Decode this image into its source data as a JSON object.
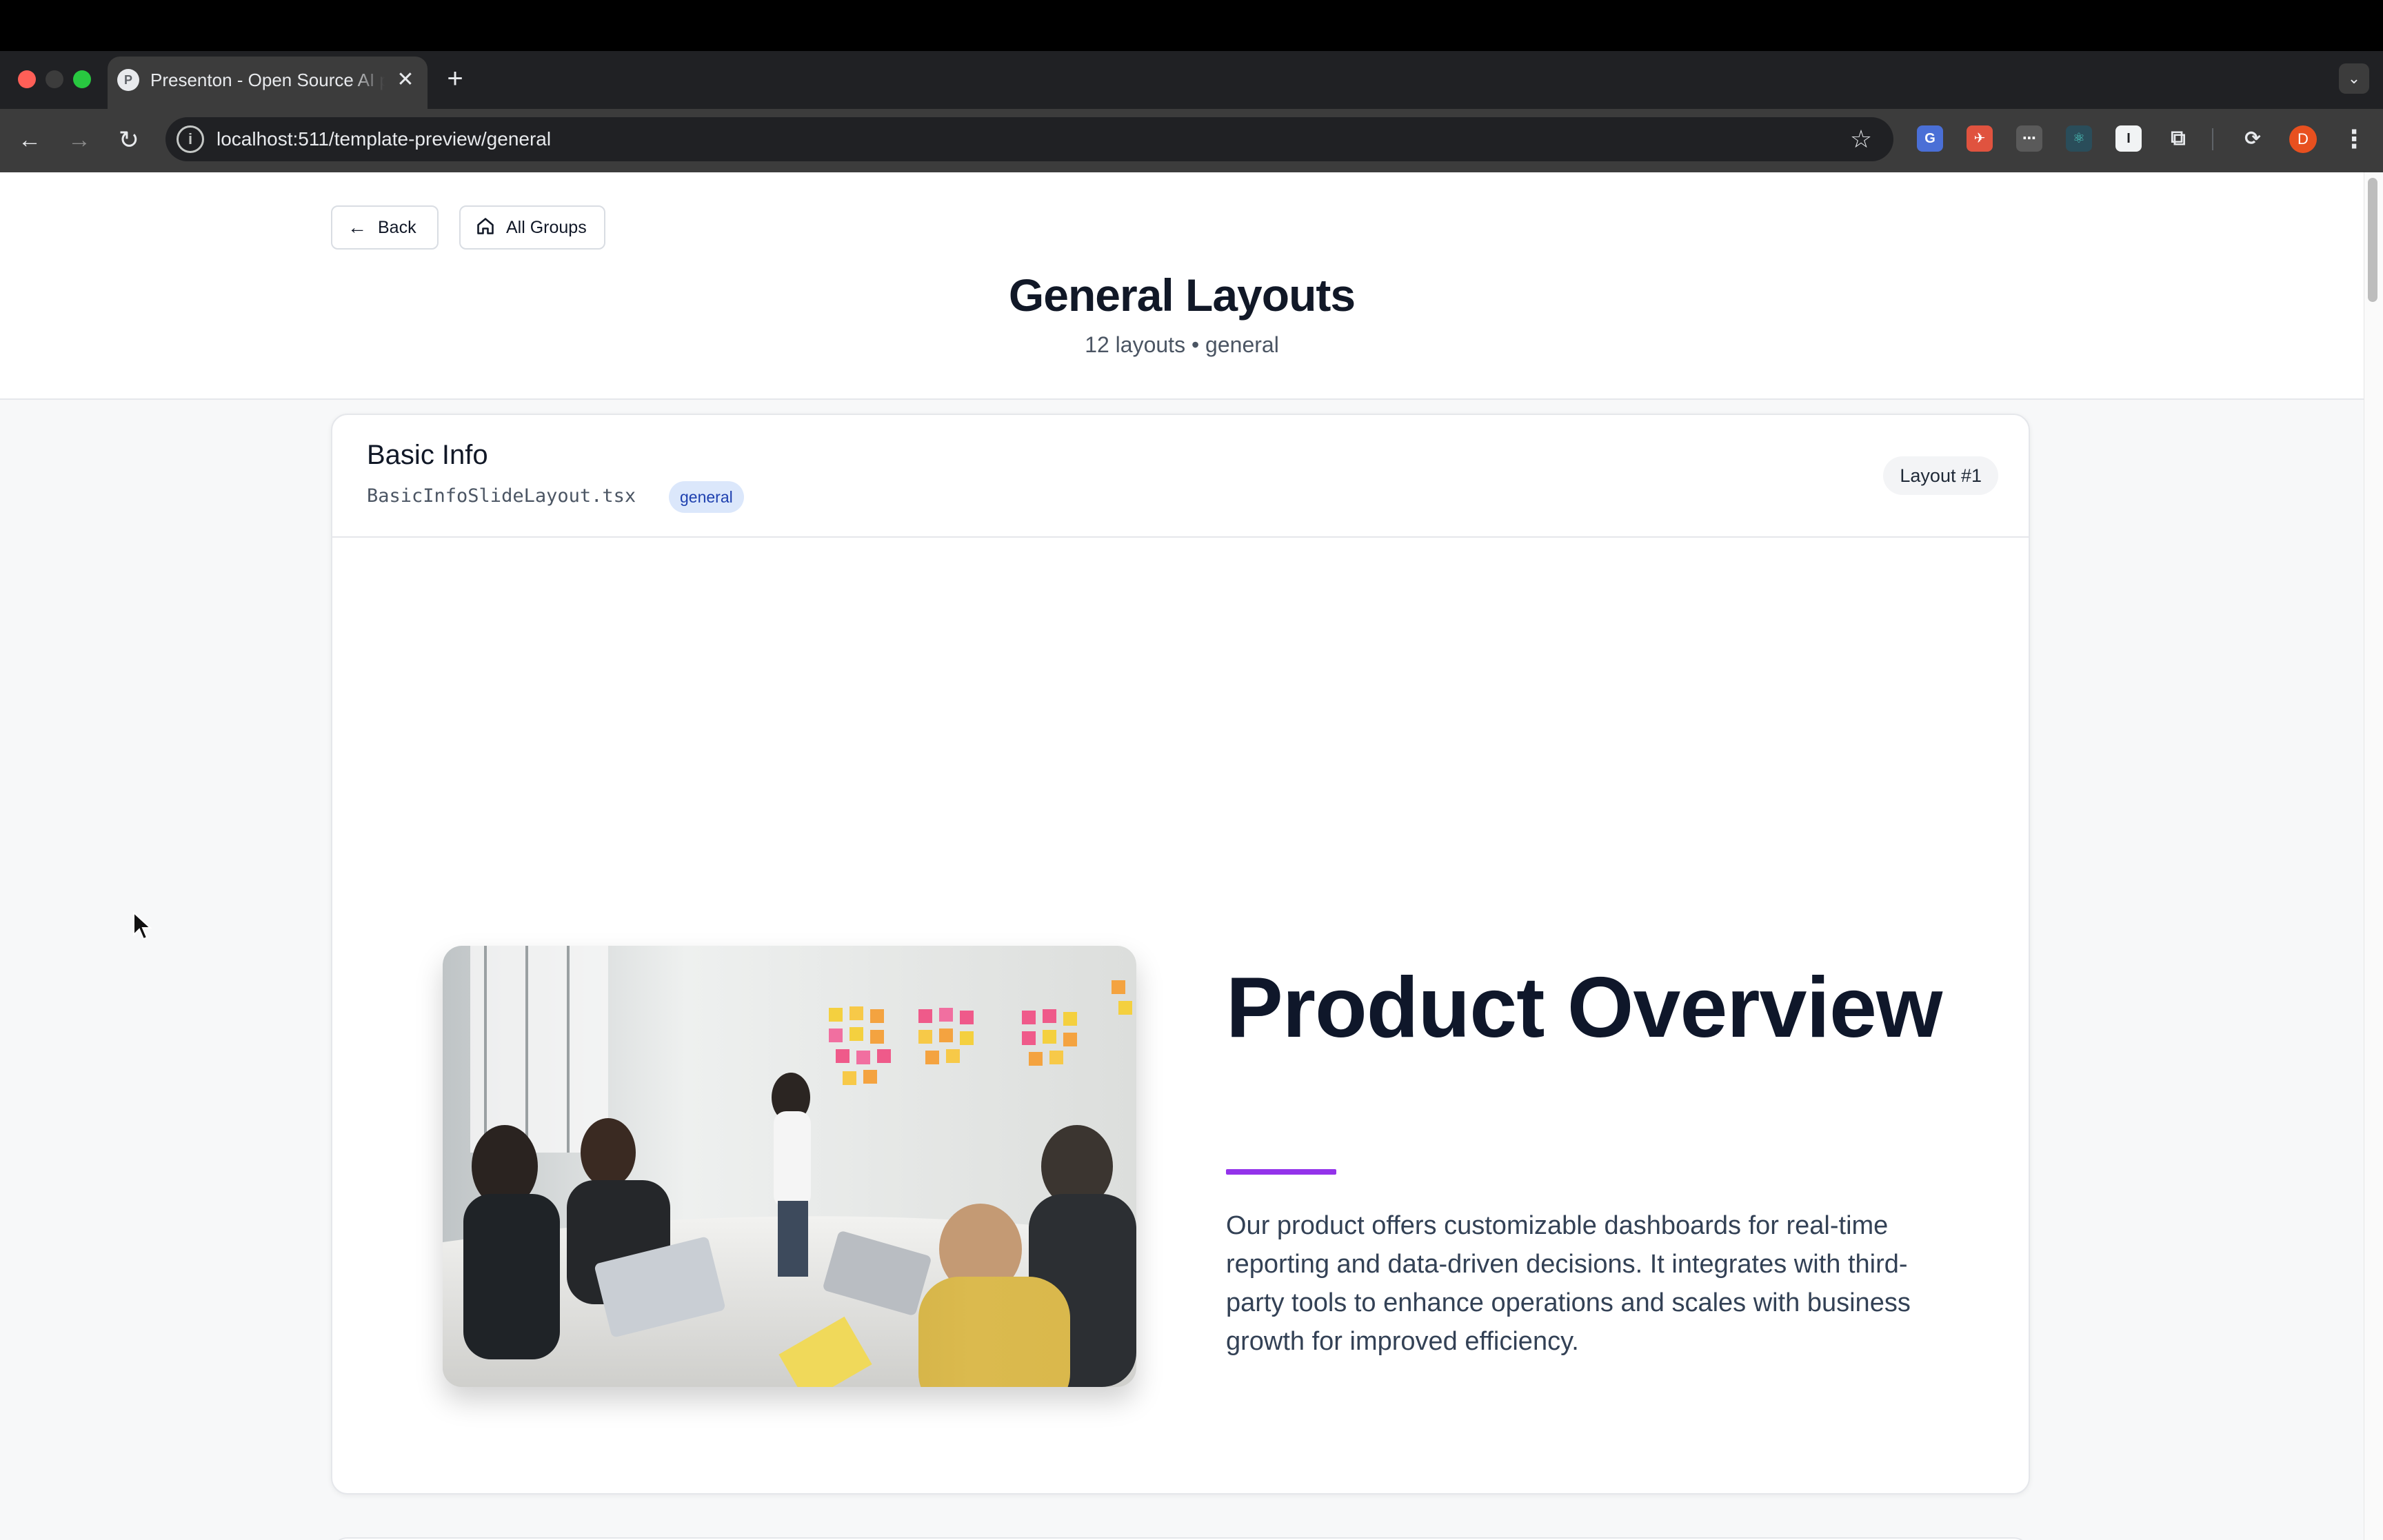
{
  "browser": {
    "tab_title": "Presenton - Open Source AI presentation generator",
    "tab_favicon": "P",
    "tab_close": "✕",
    "new_tab": "+",
    "tab_search": "⌄",
    "url": "localhost:511/template-preview/general",
    "site_info_icon": "i",
    "avatar_letter": "D",
    "extensions": [
      "translate-icon",
      "rocket-icon",
      "dots-icon",
      "react-icon",
      "i-icon",
      "puzzle-icon",
      "speed-icon"
    ]
  },
  "header": {
    "back_label": "Back",
    "all_groups_label": "All Groups",
    "title": "General Layouts",
    "subtitle": "12 layouts • general"
  },
  "card": {
    "title": "Basic Info",
    "file": "BasicInfoSlideLayout.tsx",
    "tag": "general",
    "badge": "Layout #1"
  },
  "slide": {
    "heading": "Product Overview",
    "body": "Our product offers customizable dashboards for real-time reporting and data-driven decisions. It integrates with third-party tools to enhance operations and scales with business growth for improved efficiency.",
    "accent_color": "#9333ea",
    "image_alt": "team meeting photo"
  }
}
